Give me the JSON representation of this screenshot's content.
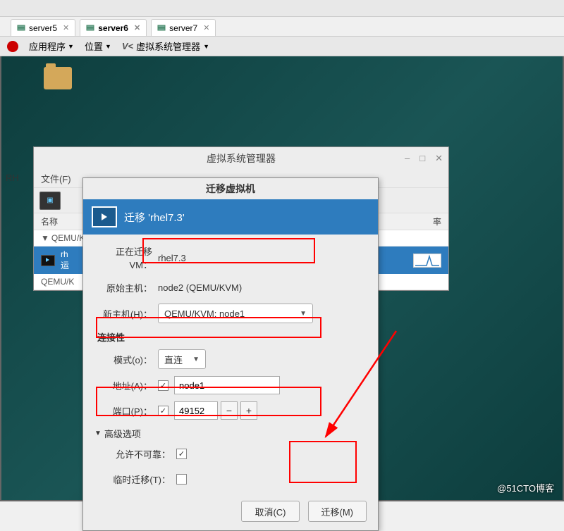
{
  "tabs": [
    {
      "label": "server5",
      "active": false
    },
    {
      "label": "server6",
      "active": true
    },
    {
      "label": "server7",
      "active": false
    }
  ],
  "gnome": {
    "apps": "应用程序",
    "places": "位置",
    "vmm": "虚拟系统管理器"
  },
  "side_label": "RH",
  "vmm_window": {
    "title": "虚拟系统管理器",
    "file_menu": "文件(F)",
    "col_name": "名称",
    "col_rate": "率",
    "conn1": "QEMU/K",
    "vm1_name": "rh",
    "vm1_status": "运",
    "conn2": "QEMU/K"
  },
  "migrate": {
    "title": "迁移虚拟机",
    "banner": "迁移 'rhel7.3'",
    "migrating_label": "正在迁移 VM：",
    "migrating_value": "rhel7.3",
    "orig_host_label": "原始主机：",
    "orig_host_value": "node2 (QEMU/KVM)",
    "new_host_label": "新主机(H)：",
    "new_host_value": "QEMU/KVM: node1",
    "connectivity": "连接性",
    "mode_label": "模式(o)：",
    "mode_value": "直连",
    "addr_label": "地址(A)：",
    "addr_value": "node1",
    "port_label": "端口(P)：",
    "port_value": "49152",
    "advanced": "高级选项",
    "allow_unsafe": "允许不可靠：",
    "temp_migrate": "临时迁移(T)：",
    "cancel": "取消(C)",
    "migrate_btn": "迁移(M)"
  },
  "watermark": "@51CTO博客"
}
